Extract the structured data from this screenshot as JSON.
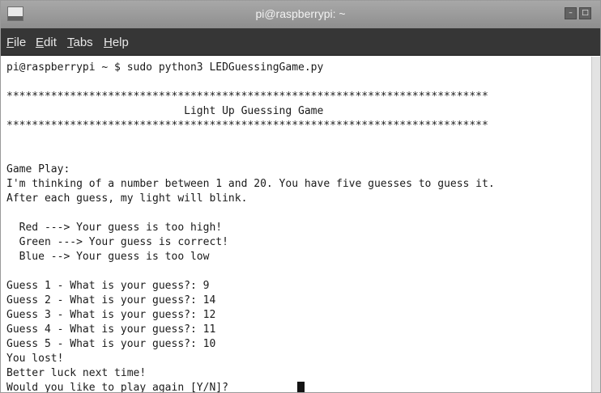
{
  "window": {
    "title": "pi@raspberrypi: ~",
    "minimize_glyph": "–",
    "maximize_glyph": "□",
    "close_glyph": "×"
  },
  "menu": [
    {
      "mnemonic": "F",
      "rest": "ile"
    },
    {
      "mnemonic": "E",
      "rest": "dit"
    },
    {
      "mnemonic": "T",
      "rest": "abs"
    },
    {
      "mnemonic": "H",
      "rest": "elp"
    }
  ],
  "terminal": {
    "lines": [
      "pi@raspberrypi ~ $ sudo python3 LEDGuessingGame.py",
      "",
      "****************************************************************************",
      "                            Light Up Guessing Game",
      "****************************************************************************",
      "",
      "",
      "Game Play:",
      "I'm thinking of a number between 1 and 20. You have five guesses to guess it.",
      "After each guess, my light will blink.",
      "",
      "  Red ---> Your guess is too high!",
      "  Green ---> Your guess is correct!",
      "  Blue --> Your guess is too low",
      "",
      "Guess 1 - What is your guess?: 9",
      "Guess 2 - What is your guess?: 14",
      "Guess 3 - What is your guess?: 12",
      "Guess 4 - What is your guess?: 11",
      "Guess 5 - What is your guess?: 10",
      "You lost!",
      "Better luck next time!",
      "Would you like to play again [Y/N]? "
    ]
  },
  "colors": {
    "titlebar": "#9b9b9b",
    "menubar": "#363636",
    "terminal_bg": "#ffffff",
    "terminal_fg": "#1a1a1a"
  },
  "icons": [
    "terminal-app-icon",
    "minimize-icon",
    "maximize-icon",
    "close-icon",
    "text-cursor"
  ]
}
